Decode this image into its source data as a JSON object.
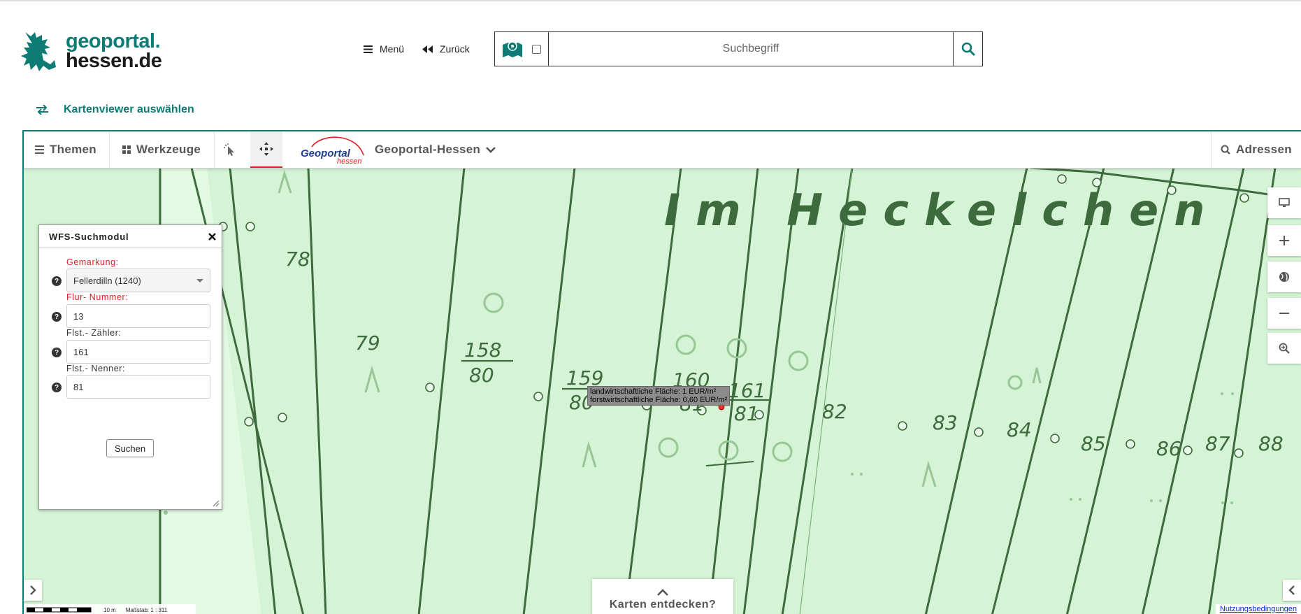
{
  "header": {
    "logo_line1": "geoportal.",
    "logo_line2": "hessen.de",
    "menu_label": "Menü",
    "back_label": "Zurück",
    "search_placeholder": "Suchbegriff",
    "viewer_select_label": "Kartenviewer auswählen"
  },
  "toolbar": {
    "themes_label": "Themen",
    "tools_label": "Werkzeuge",
    "portal_logo_text_1": "Geoportal",
    "portal_logo_text_2": "hessen",
    "portal_name": "Geoportal-Hessen",
    "address_label": "Adressen"
  },
  "wfs": {
    "title": "WFS-Suchmodul",
    "gemarkung_label": "Gemarkung:",
    "gemarkung_value": "Fellerdilln (1240)",
    "flur_label": "Flur- Nummer:",
    "flur_value": "13",
    "zaehler_label": "Flst.- Zähler:",
    "zaehler_value": "161",
    "nenner_label": "Flst.- Nenner:",
    "nenner_value": "81",
    "search_button": "Suchen"
  },
  "map": {
    "area_name": "Im Heckelchen",
    "parcels": [
      {
        "num": "78"
      },
      {
        "num": "79"
      },
      {
        "num": "158",
        "den": "80"
      },
      {
        "num": "159",
        "den": "80"
      },
      {
        "num": "160",
        "den": "81"
      },
      {
        "num": "161",
        "den": "81"
      },
      {
        "num": "82"
      },
      {
        "num": "83"
      },
      {
        "num": "84"
      },
      {
        "num": "85"
      },
      {
        "num": "86"
      },
      {
        "num": "87"
      },
      {
        "num": "88"
      }
    ],
    "tooltip_line1": "landwirtschaftliche Fläche: 1 EUR/m²",
    "tooltip_line2": "forstwirtschaftliche Fläche: 0,60 EUR/m²",
    "discover_label": "Karten entdecken?",
    "scale_distance": "10 m",
    "scale_text": "Maßstab: 1 : 311",
    "terms_link": "Nutzungsbedingungen"
  },
  "colors": {
    "brand": "#0d7c74",
    "map_bg": "#d5f3d5",
    "map_lines": "#3d6b3d",
    "required_label": "#e0202a"
  },
  "icons": [
    "lion-logo-icon",
    "menu-icon",
    "back-icon",
    "map-icon",
    "search-icon",
    "swap-icon",
    "grid-icon",
    "pointer-icon",
    "move-icon",
    "chevron-down-icon",
    "monitor-icon",
    "plus-icon",
    "globe-icon",
    "minus-icon",
    "zoom-icon",
    "close-icon",
    "help-icon",
    "chevron-up-icon",
    "chevron-right-icon",
    "chevron-left-icon"
  ]
}
